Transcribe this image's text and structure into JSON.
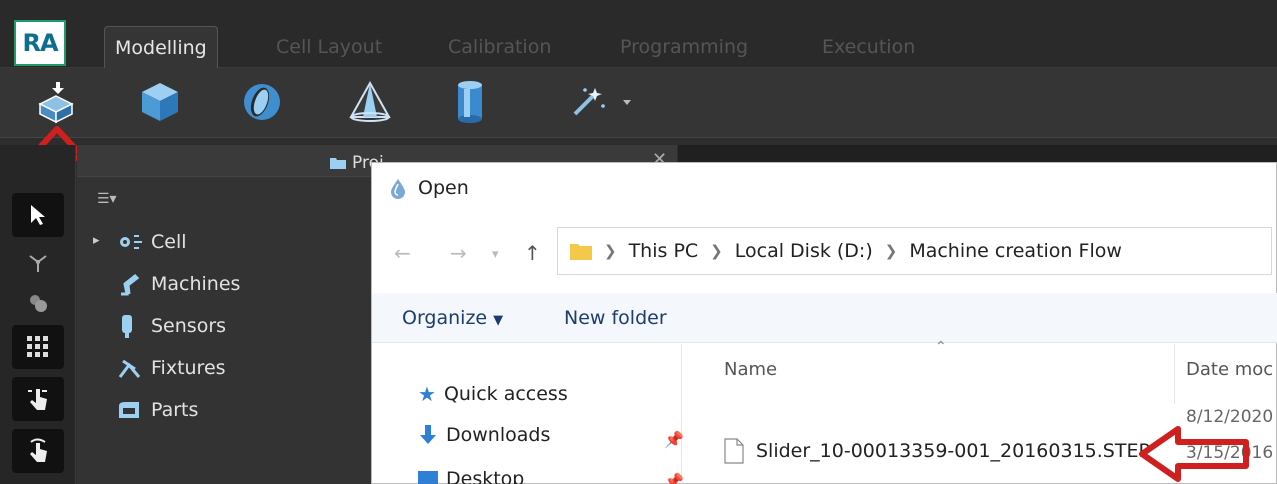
{
  "app": {
    "logo_text": "RA",
    "tabs": [
      {
        "label": "Modelling",
        "active": true
      },
      {
        "label": "Cell Layout",
        "active": false
      },
      {
        "label": "Calibration",
        "active": false
      },
      {
        "label": "Programming",
        "active": false
      },
      {
        "label": "Execution",
        "active": false
      }
    ]
  },
  "toolbar": {
    "icons": [
      "import-model-icon",
      "box-icon",
      "sphere-icon",
      "cone-icon",
      "cylinder-icon",
      "magic-wand-icon"
    ]
  },
  "project_panel": {
    "title": "Proj",
    "tree": [
      {
        "label": "Cell",
        "icon": "cell-icon"
      },
      {
        "label": "Machines",
        "icon": "robot-arm-icon"
      },
      {
        "label": "Sensors",
        "icon": "sensor-icon"
      },
      {
        "label": "Fixtures",
        "icon": "fixture-icon"
      },
      {
        "label": "Parts",
        "icon": "part-icon"
      }
    ]
  },
  "dialog": {
    "title": "Open",
    "breadcrumb": [
      "This PC",
      "Local Disk (D:)",
      "Machine creation Flow"
    ],
    "commands": {
      "organize": "Organize",
      "new_folder": "New folder"
    },
    "nav": [
      {
        "label": "Quick access"
      },
      {
        "label": "Downloads"
      },
      {
        "label": "Desktop"
      }
    ],
    "columns": {
      "name": "Name",
      "date": "Date moc"
    },
    "dates": [
      "8/12/2020",
      "3/15/2016"
    ],
    "file": {
      "name": "Slider_10-00013359-001_20160315.STEP"
    }
  },
  "colors": {
    "accent_red": "#d01f1f",
    "logo_border": "#1f9b6a"
  }
}
